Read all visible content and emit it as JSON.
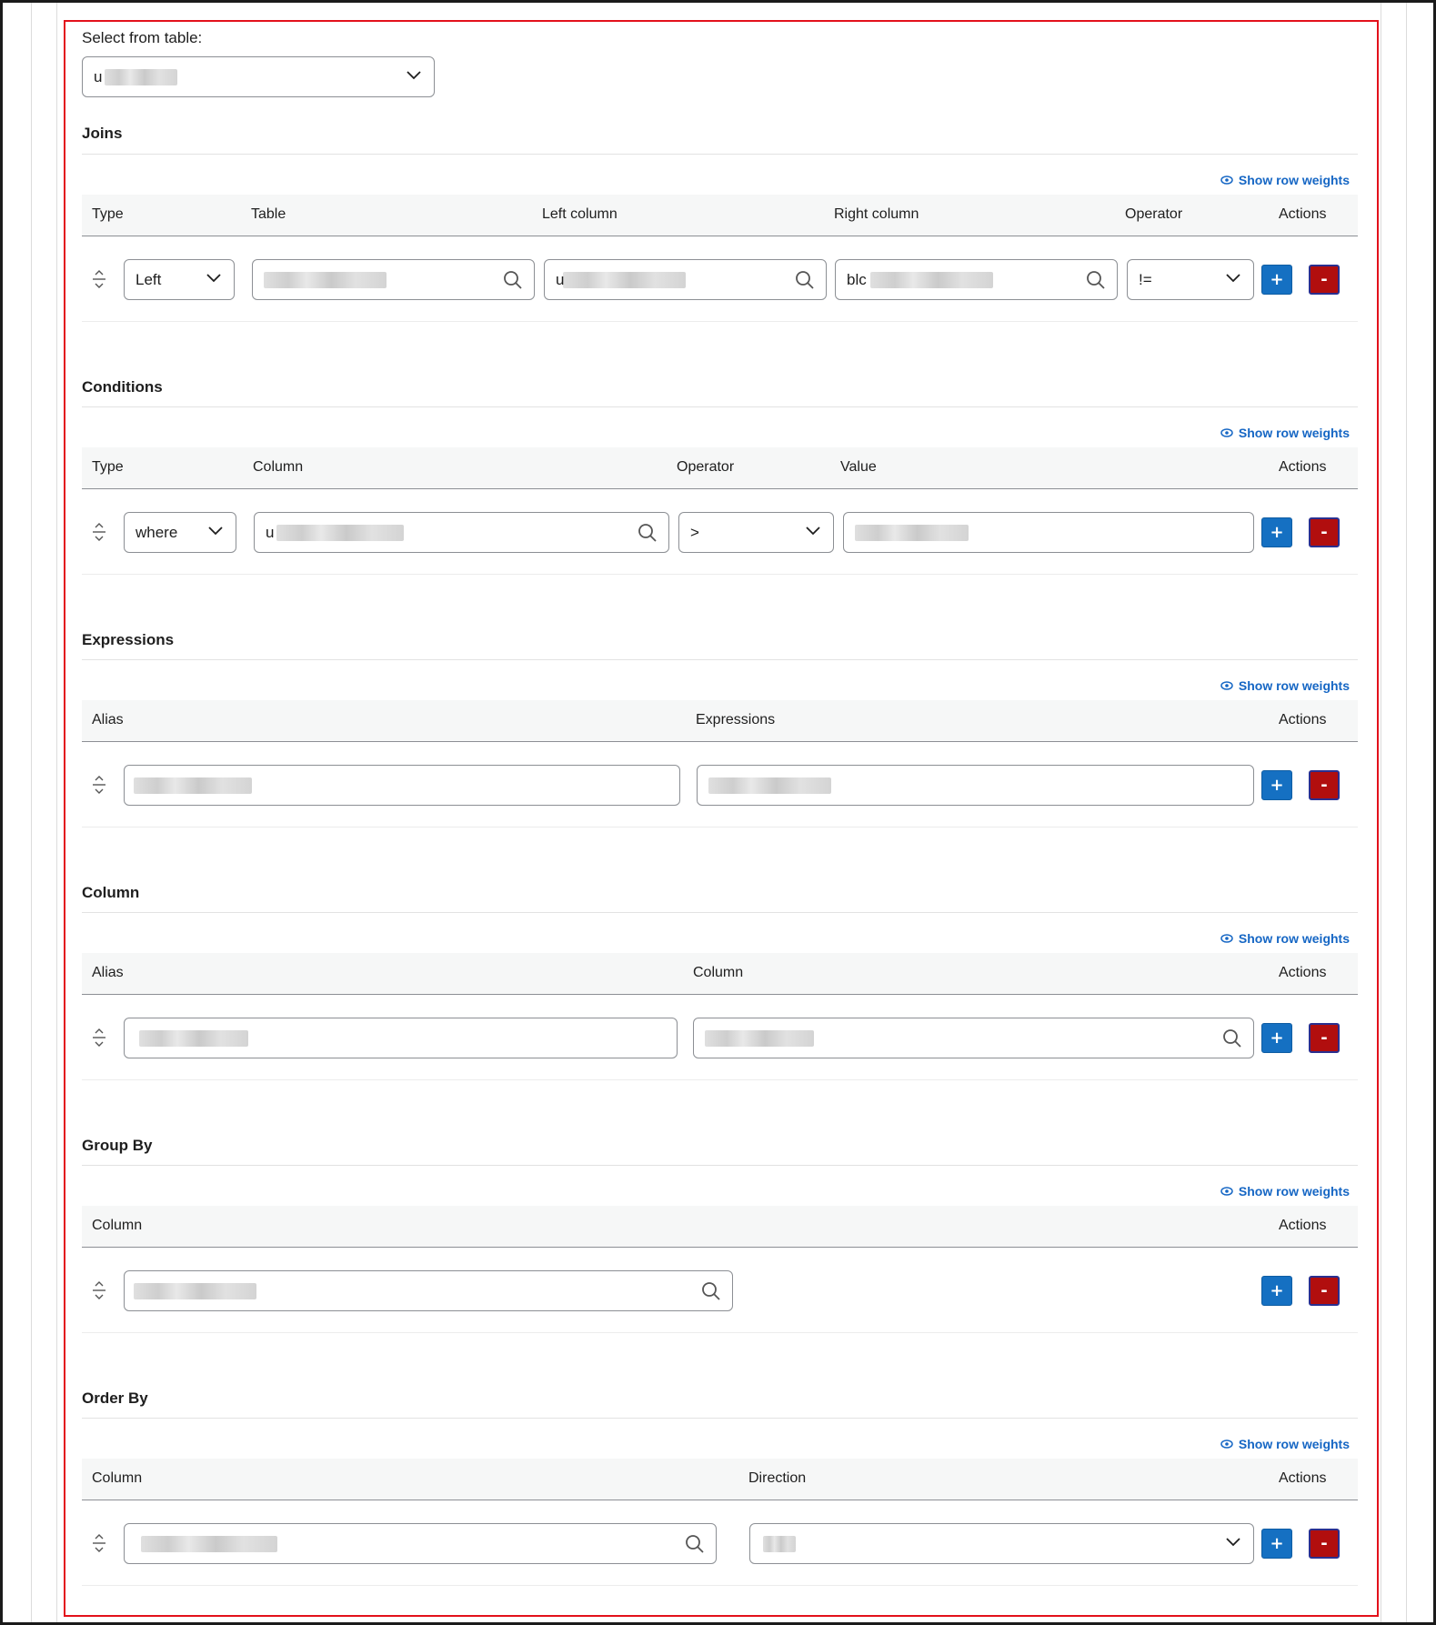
{
  "select_from_table": {
    "label": "Select from table:",
    "value": "u"
  },
  "row_weights_label": "Show row weights",
  "joins": {
    "title": "Joins",
    "headers": [
      "Type",
      "Table",
      "Left column",
      "Right column",
      "Operator",
      "Actions"
    ],
    "row": {
      "type": "Left",
      "table": "",
      "left_column": "u",
      "right_column": "blc",
      "operator": "!="
    }
  },
  "conditions": {
    "title": "Conditions",
    "headers": [
      "Type",
      "Column",
      "Operator",
      "Value",
      "Actions"
    ],
    "row": {
      "type": "where",
      "column": "u",
      "operator": ">",
      "value": ""
    }
  },
  "expressions": {
    "title": "Expressions",
    "headers": [
      "Alias",
      "Expressions",
      "Actions"
    ],
    "row": {
      "alias": "",
      "expression": ""
    }
  },
  "column": {
    "title": "Column",
    "headers": [
      "Alias",
      "Column",
      "Actions"
    ],
    "row": {
      "alias": "",
      "column": ""
    }
  },
  "group_by": {
    "title": "Group By",
    "headers": [
      "Column",
      "Actions"
    ],
    "row": {
      "column": ""
    }
  },
  "order_by": {
    "title": "Order By",
    "headers": [
      "Column",
      "Direction",
      "Actions"
    ],
    "row": {
      "column": "",
      "direction": ""
    }
  },
  "buttons": {
    "add_label": "+",
    "remove_label": "-"
  },
  "colors": {
    "panel_border": "#e3111b",
    "link": "#1566c4",
    "add_button": "#1570c2",
    "remove_button": "#b10e0e"
  },
  "icons": [
    "eye-icon",
    "chevron-down-icon",
    "search-icon",
    "drag-handle-icon"
  ]
}
